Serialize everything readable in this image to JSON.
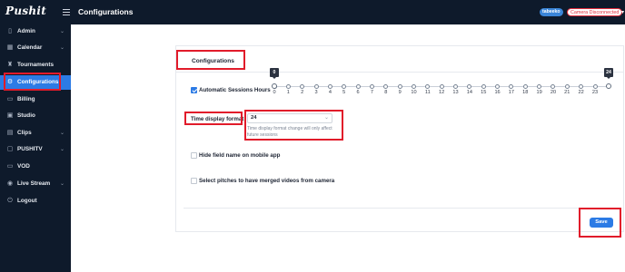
{
  "header": {
    "logo_text": "Pushit",
    "page_title": "Configurations",
    "user_badge": "tabeeko",
    "camera_status": "Camera Disconnected",
    "colors": {
      "bar": "#0e1a2b",
      "accent": "#2c7be5",
      "danger": "#e02d3c"
    }
  },
  "sidebar": {
    "items": [
      {
        "label": "Admin",
        "icon": "document-icon",
        "has_chevron": true,
        "active": false
      },
      {
        "label": "Calendar",
        "icon": "calendar-icon",
        "has_chevron": true,
        "active": false
      },
      {
        "label": "Tournaments",
        "icon": "trophy-icon",
        "has_chevron": false,
        "active": false
      },
      {
        "label": "Configurations",
        "icon": "gear-icon",
        "has_chevron": false,
        "active": true
      },
      {
        "label": "Billing",
        "icon": "billing-icon",
        "has_chevron": false,
        "active": false
      },
      {
        "label": "Studio",
        "icon": "studio-icon",
        "has_chevron": false,
        "active": false
      },
      {
        "label": "Clips",
        "icon": "clips-icon",
        "has_chevron": true,
        "active": false
      },
      {
        "label": "PUSHITV",
        "icon": "tv-icon",
        "has_chevron": true,
        "active": false
      },
      {
        "label": "VOD",
        "icon": "vod-icon",
        "has_chevron": false,
        "active": false
      },
      {
        "label": "Live Stream",
        "icon": "live-stream-icon",
        "has_chevron": true,
        "active": false
      },
      {
        "label": "Logout",
        "icon": "logout-icon",
        "has_chevron": false,
        "active": false
      }
    ]
  },
  "main": {
    "section_title": "Configurations",
    "auto_sessions": {
      "label": "Automatic Sessions Hours",
      "checked": true,
      "range_min_value": "0",
      "range_max_value": "24",
      "ticks": [
        "0",
        "1",
        "2",
        "3",
        "4",
        "5",
        "6",
        "7",
        "8",
        "9",
        "10",
        "11",
        "12",
        "13",
        "14",
        "15",
        "16",
        "17",
        "18",
        "19",
        "20",
        "21",
        "22",
        "23"
      ]
    },
    "time_format": {
      "label": "Time display format",
      "value": "24",
      "help": "Time display format change will only affect future sessions"
    },
    "hide_field_name": {
      "label": "Hide field name on mobile app",
      "checked": false
    },
    "merged_videos": {
      "label": "Select pitches to have merged videos from camera",
      "checked": false
    },
    "save_label": "Save"
  }
}
